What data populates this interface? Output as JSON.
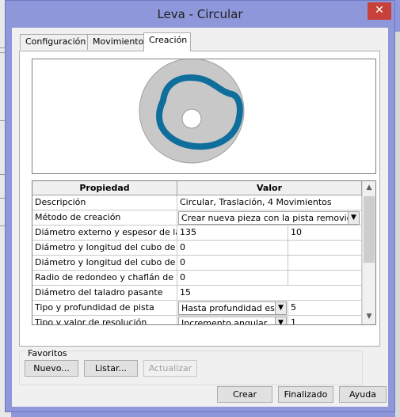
{
  "window": {
    "title": "Leva - Circular",
    "close_glyph": "✕"
  },
  "tabs": [
    {
      "label": "Configuración",
      "active": false
    },
    {
      "label": "Movimiento",
      "active": false
    },
    {
      "label": "Creación",
      "active": true
    }
  ],
  "grid": {
    "headers": [
      "Propiedad",
      "Valor"
    ],
    "rows": [
      {
        "property": "Descripción",
        "value": "Circular, Traslación, 4 Movimientos"
      },
      {
        "property": "Método de creación",
        "value": "Crear nueva pieza con la pista removida",
        "dropdown": true
      },
      {
        "property": "Diámetro externo y espesor de la pieza en bruto",
        "value": "135",
        "value2": "10"
      },
      {
        "property": "Diámetro y longitud del cubo de leva cercano",
        "value": "0",
        "value2": ""
      },
      {
        "property": "Diámetro y longitud del cubo de leva lejano",
        "value": "0",
        "value2": ""
      },
      {
        "property": "Radio de redondeo y chaflán de la pieza en bruto",
        "value": "0",
        "value2": ""
      },
      {
        "property": "Diámetro del taladro pasante",
        "value": "15"
      },
      {
        "property": "Tipo y profundidad de pista",
        "value": "Hasta profundidad especificada",
        "dropdown": true,
        "value2": "5"
      },
      {
        "property": "Tipo y valor de resolución",
        "value": "Incremento angular",
        "dropdown": true,
        "value2": "1"
      }
    ]
  },
  "favorites": {
    "label": "Favoritos",
    "buttons": {
      "new": "Nuevo...",
      "list": "Listar...",
      "update": "Actualizar"
    }
  },
  "footer": {
    "create": "Crear",
    "done": "Finalizado",
    "help": "Ayuda"
  },
  "icons": {
    "close": "close-icon",
    "dropdown": "chevron-down-icon",
    "scroll_up": "scroll-up-icon",
    "scroll_down": "scroll-down-icon"
  },
  "colors": {
    "titlebar": "#8e97d9",
    "close": "#c7413a",
    "cam_body": "#c8c8c8",
    "cam_track": "#0f6e9c"
  }
}
